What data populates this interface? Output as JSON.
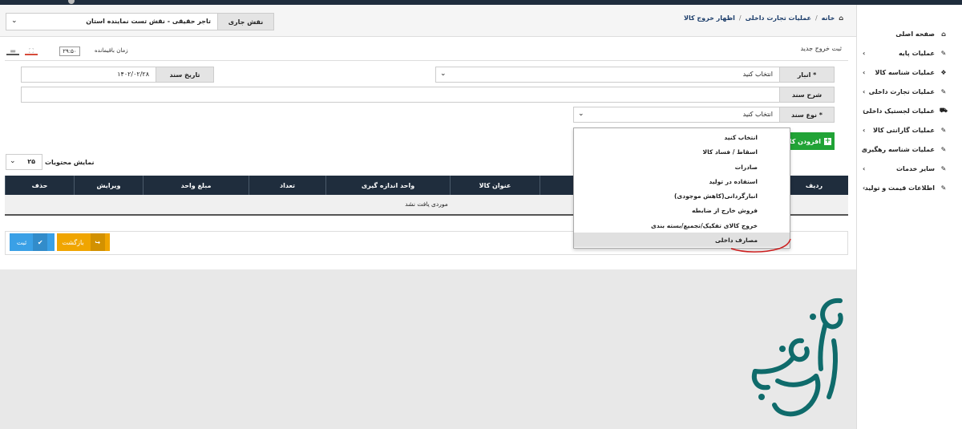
{
  "header": {
    "role_label": "نقش جاری",
    "role_value": "تاجر حقیقی - نقش تست نماینده استان",
    "breadcrumb": [
      "خانه",
      "عملیات تجارت داخلی",
      "اظهار خروج کالا"
    ]
  },
  "sidebar": {
    "items": [
      {
        "label": "صفحه اصلی",
        "icon": "home-icon",
        "has_submenu": false
      },
      {
        "label": "عملیات پایه",
        "icon": "edit-icon",
        "has_submenu": true
      },
      {
        "label": "عملیات شناسه کالا",
        "icon": "cubes-icon",
        "has_submenu": true
      },
      {
        "label": "عملیات تجارت داخلی",
        "icon": "edit-icon",
        "has_submenu": true
      },
      {
        "label": "عملیات لجستیک داخلی",
        "icon": "truck-icon",
        "has_submenu": true
      },
      {
        "label": "عملیات گارانتی کالا",
        "icon": "edit-icon",
        "has_submenu": true
      },
      {
        "label": "عملیات شناسه رهگیری",
        "icon": "edit-icon",
        "has_submenu": true
      },
      {
        "label": "سایر خدمات",
        "icon": "edit-icon",
        "has_submenu": true
      },
      {
        "label": "اطلاعات قیمت و تولید",
        "icon": "edit-icon",
        "has_submenu": true
      }
    ]
  },
  "panel": {
    "title": "ثبت خروج جدید",
    "timer_label": "زمان باقیمانده",
    "timer_value": "۲۹:۵۰"
  },
  "form": {
    "warehouse_label": "* انبار",
    "warehouse_value": "انتخاب کنید",
    "doc_date_label": "تاریخ سند",
    "doc_date_value": "۱۴۰۲/۰۲/۲۸",
    "doc_desc_label": "شرح سند",
    "doc_desc_value": "",
    "doc_type_label": "* نوع سند",
    "doc_type_value": "انتخاب کنید"
  },
  "doc_type_options": [
    "انتخاب کنید",
    "اسقاط / فساد کالا",
    "صادرات",
    "استفاده در تولید",
    "انبارگردانی(کاهش موجودی)",
    "فروش خارج از ضابطه",
    "خروج کالای تفکیک/تجمیع/بسته بندی",
    "مصارف داخلی"
  ],
  "selected_option_index": 7,
  "add_button_label": "افزودن کالا",
  "paging": {
    "show_label": "نمایش محتویات",
    "page_size": "۲۵"
  },
  "table": {
    "columns": [
      "ردیف",
      "",
      "عنوان کالا",
      "واحد اندازه گیری",
      "تعداد",
      "مبلغ واحد",
      "ویرایش",
      "حذف"
    ],
    "empty_text": "موردی یافت نشد"
  },
  "footer": {
    "save_label": "ثبت",
    "back_label": "بازگشت"
  },
  "colors": {
    "topbar": "#1f2d3d",
    "add_button": "#21a336",
    "save_button": "#3aa0e6",
    "back_button": "#f0a500",
    "watermark": "#0f6b6b"
  }
}
